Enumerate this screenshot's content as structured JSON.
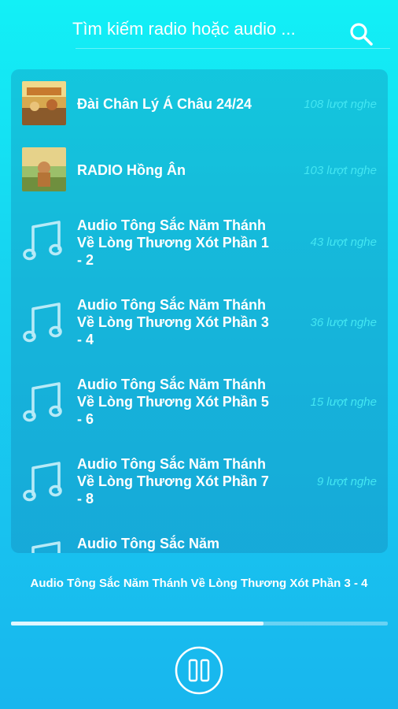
{
  "search": {
    "placeholder": "Tìm kiếm radio hoặc audio ...",
    "icon": "search-icon"
  },
  "list": [
    {
      "title": "Đài Chân Lý Á Châu 24/24",
      "count": "108 lượt nghe",
      "icon": "radio-thumbnail"
    },
    {
      "title": "RADIO Hồng Ân",
      "count": "103 lượt nghe",
      "icon": "radio-thumbnail"
    },
    {
      "title": "Audio Tông Sắc Năm Thánh Về Lòng Thương Xót Phần 1 - 2",
      "count": "43 lượt nghe",
      "icon": "music-note-icon"
    },
    {
      "title": "Audio Tông Sắc Năm Thánh Về Lòng Thương Xót Phần 3 - 4",
      "count": "36 lượt nghe",
      "icon": "music-note-icon"
    },
    {
      "title": "Audio Tông Sắc Năm Thánh Về Lòng Thương Xót Phần 5 - 6",
      "count": "15 lượt nghe",
      "icon": "music-note-icon"
    },
    {
      "title": "Audio Tông Sắc Năm Thánh Về Lòng Thương Xót Phần 7 - 8",
      "count": "9 lượt nghe",
      "icon": "music-note-icon"
    },
    {
      "title": "Audio Tông Sắc Năm",
      "count": "",
      "icon": "music-note-icon"
    }
  ],
  "player": {
    "now_playing": "Audio Tông Sắc Năm Thánh Về Lòng Thương Xót Phần 3 - 4",
    "progress": 0.67,
    "control_icon": "pause-icon"
  },
  "colors": {
    "accent": "#43e6f2",
    "text": "#ffffff"
  }
}
